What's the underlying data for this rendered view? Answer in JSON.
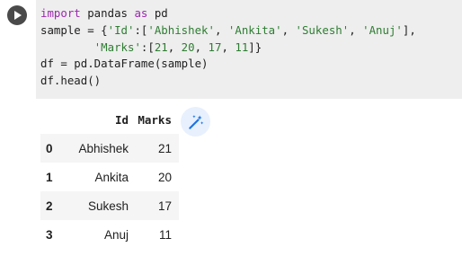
{
  "cell": {
    "run_icon": "play-icon",
    "code_lines": [
      "import pandas as pd",
      "sample = {'Id':['Abhishek', 'Ankita', 'Sukesh', 'Anuj'],",
      "        'Marks':[21, 20, 17, 11]}",
      "df = pd.DataFrame(sample)",
      "df.head()"
    ]
  },
  "output": {
    "columns": [
      "",
      "Id",
      "Marks"
    ],
    "rows": [
      {
        "index": "0",
        "id": "Abhishek",
        "marks": "21"
      },
      {
        "index": "1",
        "id": "Ankita",
        "marks": "20"
      },
      {
        "index": "2",
        "id": "Sukesh",
        "marks": "17"
      },
      {
        "index": "3",
        "id": "Anuj",
        "marks": "11"
      }
    ],
    "magic_icon": "magic-wand-icon"
  },
  "colors": {
    "keyword": "#9c27b0",
    "string": "#2e7d32",
    "code_bg": "#eeeeee",
    "run_button": "#4a4a4a",
    "magic_button_bg": "#e8f0fe",
    "magic_icon": "#1a73e8"
  }
}
